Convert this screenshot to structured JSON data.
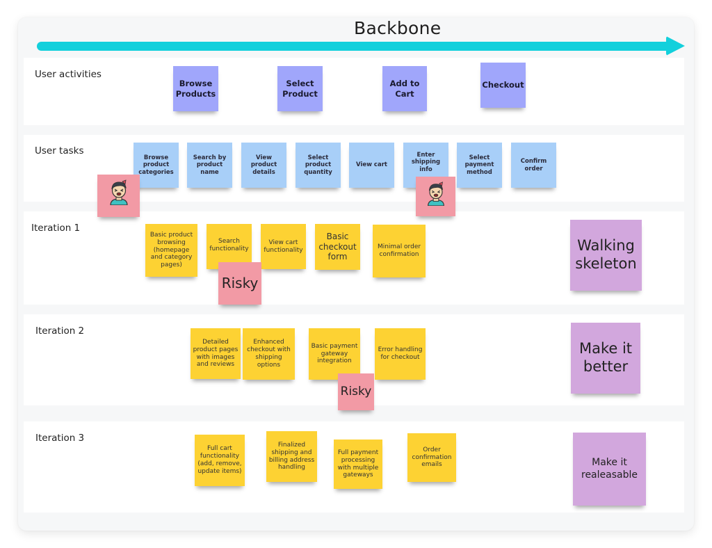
{
  "backbone": {
    "title": "Backbone",
    "arrow_color": "#13d0dc"
  },
  "colors": {
    "activity": "#a0a6fb",
    "task": "#a8cff8",
    "story": "#fdd233",
    "risky": "#f29aa5",
    "goal": "#d2a7dd"
  },
  "lanes": {
    "activities": {
      "label": "User activities"
    },
    "tasks": {
      "label": "User tasks"
    },
    "iteration1": {
      "label": "Iteration 1"
    },
    "iteration2": {
      "label": "Iteration 2"
    },
    "iteration3": {
      "label": "Iteration 3"
    }
  },
  "activities": [
    "Browse Products",
    "Select Product",
    "Add to Cart",
    "Checkout"
  ],
  "tasks": [
    "Browse product categories",
    "Search by product name",
    "View product details",
    "Select product quantity",
    "View cart",
    "Enter shipping info",
    "Select payment method",
    "Confirm order"
  ],
  "pain_points": [
    {
      "icon": "frustrated-face-icon"
    },
    {
      "icon": "frustrated-face-icon"
    }
  ],
  "iteration1": {
    "stories": [
      "Basic product browsing (homepage and category pages)",
      "Search functionality",
      "View cart functionality",
      "Basic checkout form",
      "Minimal order confirmation"
    ],
    "risky_label": "Risky",
    "goal": "Walking skeleton"
  },
  "iteration2": {
    "stories": [
      "Detailed product pages with images and reviews",
      "Enhanced checkout with shipping options",
      "Basic payment gateway integration",
      "Error handling for checkout"
    ],
    "risky_label": "Risky",
    "goal": "Make it better"
  },
  "iteration3": {
    "stories": [
      "Full cart functionality (add, remove, update items)",
      "Finalized shipping and billing address handling",
      "Full payment processing with multiple gateways",
      "Order confirmation emails"
    ],
    "goal": "Make it realeasable"
  }
}
